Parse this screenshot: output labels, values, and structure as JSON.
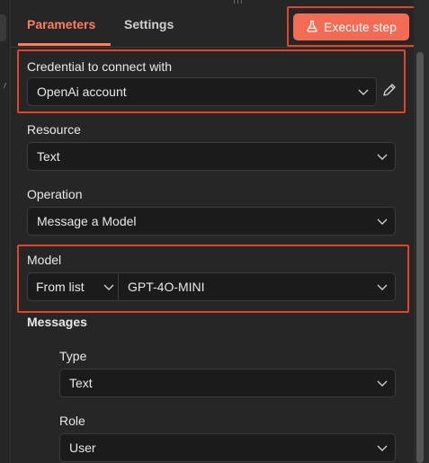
{
  "tabs": {
    "parameters": "Parameters",
    "settings": "Settings"
  },
  "execute_button": {
    "label": "Execute step",
    "icon": "flask-icon"
  },
  "credential": {
    "label": "Credential to connect with",
    "value": "OpenAi account",
    "edit_icon": "pencil-icon"
  },
  "resource": {
    "label": "Resource",
    "value": "Text"
  },
  "operation": {
    "label": "Operation",
    "value": "Message a Model"
  },
  "model": {
    "label": "Model",
    "mode": "From list",
    "value": "GPT-4O-MINI"
  },
  "messages": {
    "label": "Messages",
    "type": {
      "label": "Type",
      "value": "Text"
    },
    "role": {
      "label": "Role",
      "value": "User"
    }
  },
  "colors": {
    "accent": "#ff7d5c",
    "button": "#f26b55",
    "highlight": "#e0452b"
  }
}
